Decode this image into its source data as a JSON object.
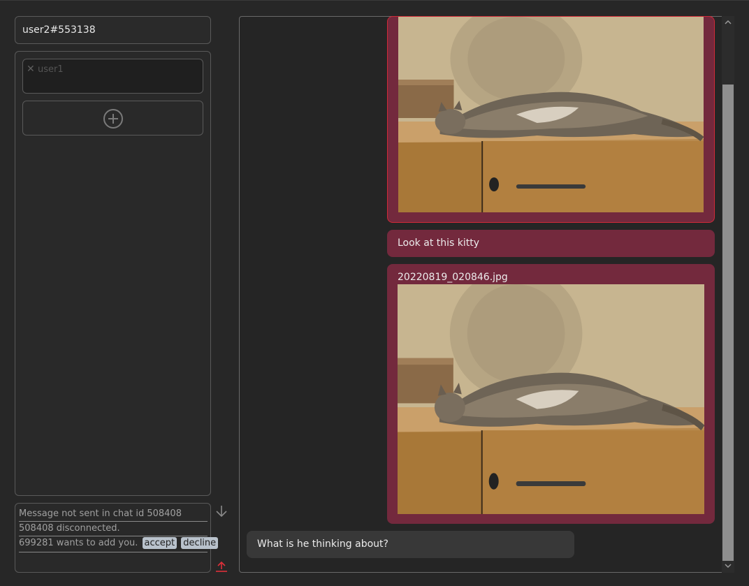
{
  "identity": {
    "user_tag": "user2#553138"
  },
  "contacts": [
    {
      "name": "user1",
      "remove_symbol": "✕"
    }
  ],
  "notifications": [
    {
      "text": "Message not sent in chat id 508408"
    },
    {
      "text": "508408 disconnected."
    },
    {
      "text": "699281 wants to add you.",
      "accept_label": "accept",
      "decline_label": "decline"
    }
  ],
  "chat": {
    "messages": [
      {
        "type": "image",
        "direction": "outgoing",
        "filename": "",
        "content": "photo of tabby cat lying on wooden cabinet"
      },
      {
        "type": "text",
        "direction": "outgoing",
        "text": "Look at this kitty"
      },
      {
        "type": "image",
        "direction": "outgoing",
        "filename": "20220819_020846.jpg",
        "content": "photo of tabby cat lying on wooden cabinet"
      },
      {
        "type": "text",
        "direction": "incoming",
        "text": "What is he thinking about?"
      }
    ]
  },
  "colors": {
    "background": "#272727",
    "outgoing_bubble": "#73293d",
    "incoming_bubble": "#383838",
    "selected_border": "#d02a38",
    "upload_icon": "#e0303a"
  },
  "icons": [
    "close-icon",
    "plus-circle-icon",
    "arrow-down-icon",
    "upload-icon",
    "chevron-up-icon",
    "chevron-down-icon"
  ]
}
